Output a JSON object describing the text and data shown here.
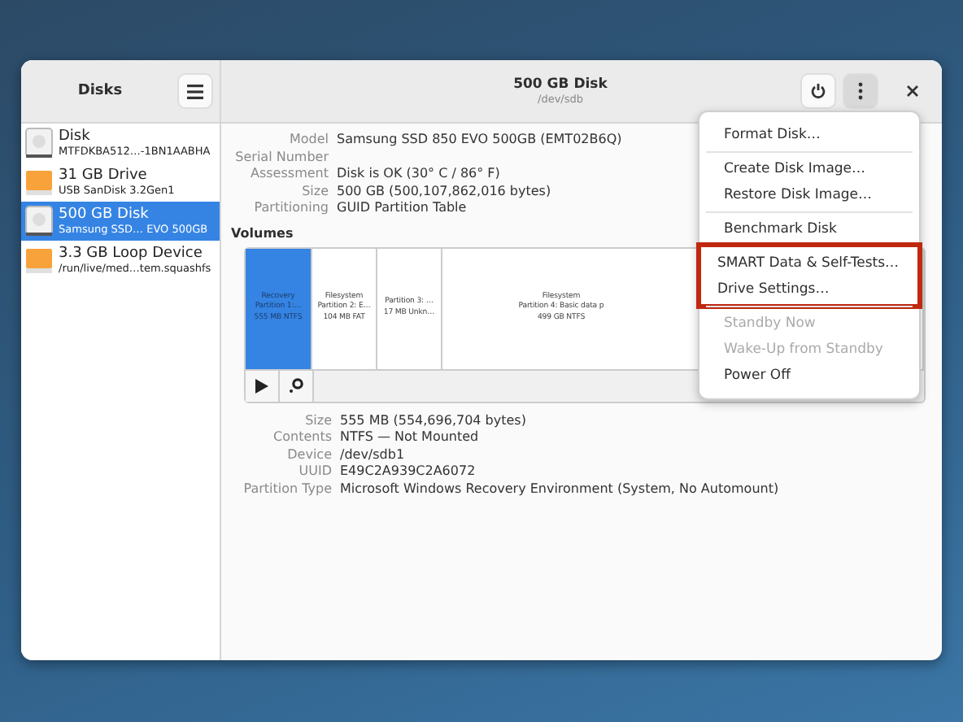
{
  "sidebar": {
    "title": "Disks",
    "items": [
      {
        "name": "Disk",
        "detail": "MTFDKBA512…-1BN1AABHA",
        "kind": "disk",
        "selected": false
      },
      {
        "name": "31 GB Drive",
        "detail": "USB SanDisk 3.2Gen1",
        "kind": "drive",
        "selected": false
      },
      {
        "name": "500 GB Disk",
        "detail": "Samsung SSD…  EVO 500GB",
        "kind": "disk",
        "selected": true
      },
      {
        "name": "3.3 GB Loop Device",
        "detail": "/run/live/med…tem.squashfs",
        "kind": "drive",
        "selected": false
      }
    ]
  },
  "header": {
    "title": "500 GB Disk",
    "subtitle": "/dev/sdb"
  },
  "disk_info": [
    {
      "label": "Model",
      "value": "Samsung SSD 850 EVO 500GB (EMT02B6Q)"
    },
    {
      "label": "Serial Number"
    },
    {
      "label": "Assessment",
      "value": "Disk is OK (30° C / 86° F)"
    },
    {
      "label": "Size",
      "value": "500 GB (500,107,862,016 bytes)"
    },
    {
      "label": "Partitioning",
      "value": "GUID Partition Table"
    }
  ],
  "volumes_heading": "Volumes",
  "partitions": [
    {
      "lines": [
        "Recovery",
        "Partition 1:…",
        "555 MB NTFS"
      ],
      "selected": true
    },
    {
      "lines": [
        "Filesystem",
        "Partition 2: E…",
        "104 MB FAT"
      ],
      "selected": false
    },
    {
      "lines": [
        "Partition 3: …",
        "17 MB Unkn…"
      ],
      "selected": false
    },
    {
      "lines": [
        "Filesystem",
        "Partition 4: Basic data p",
        "499 GB NTFS"
      ],
      "selected": false
    }
  ],
  "partition_info": [
    {
      "label": "Size",
      "value": "555 MB (554,696,704 bytes)"
    },
    {
      "label": "Contents",
      "value": "NTFS — Not Mounted"
    },
    {
      "label": "Device",
      "value": "/dev/sdb1"
    },
    {
      "label": "UUID",
      "value": "E49C2A939C2A6072"
    },
    {
      "label": "Partition Type",
      "value": "Microsoft Windows Recovery Environment (System, No Automount)"
    }
  ],
  "menu": [
    {
      "highlighted": false,
      "items": [
        {
          "label": "Format Disk…",
          "disabled": false
        }
      ]
    },
    {
      "highlighted": false,
      "items": [
        {
          "label": "Create Disk Image…",
          "disabled": false
        },
        {
          "label": "Restore Disk Image…",
          "disabled": false
        }
      ]
    },
    {
      "highlighted": false,
      "items": [
        {
          "label": "Benchmark Disk",
          "disabled": false
        }
      ]
    },
    {
      "highlighted": true,
      "items": [
        {
          "label": "SMART Data & Self-Tests…",
          "disabled": false
        },
        {
          "label": "Drive Settings…",
          "disabled": false
        }
      ]
    },
    {
      "highlighted": false,
      "items": [
        {
          "label": "Standby Now",
          "disabled": true
        },
        {
          "label": "Wake-Up from Standby",
          "disabled": true
        },
        {
          "label": "Power Off",
          "disabled": false
        }
      ]
    }
  ]
}
